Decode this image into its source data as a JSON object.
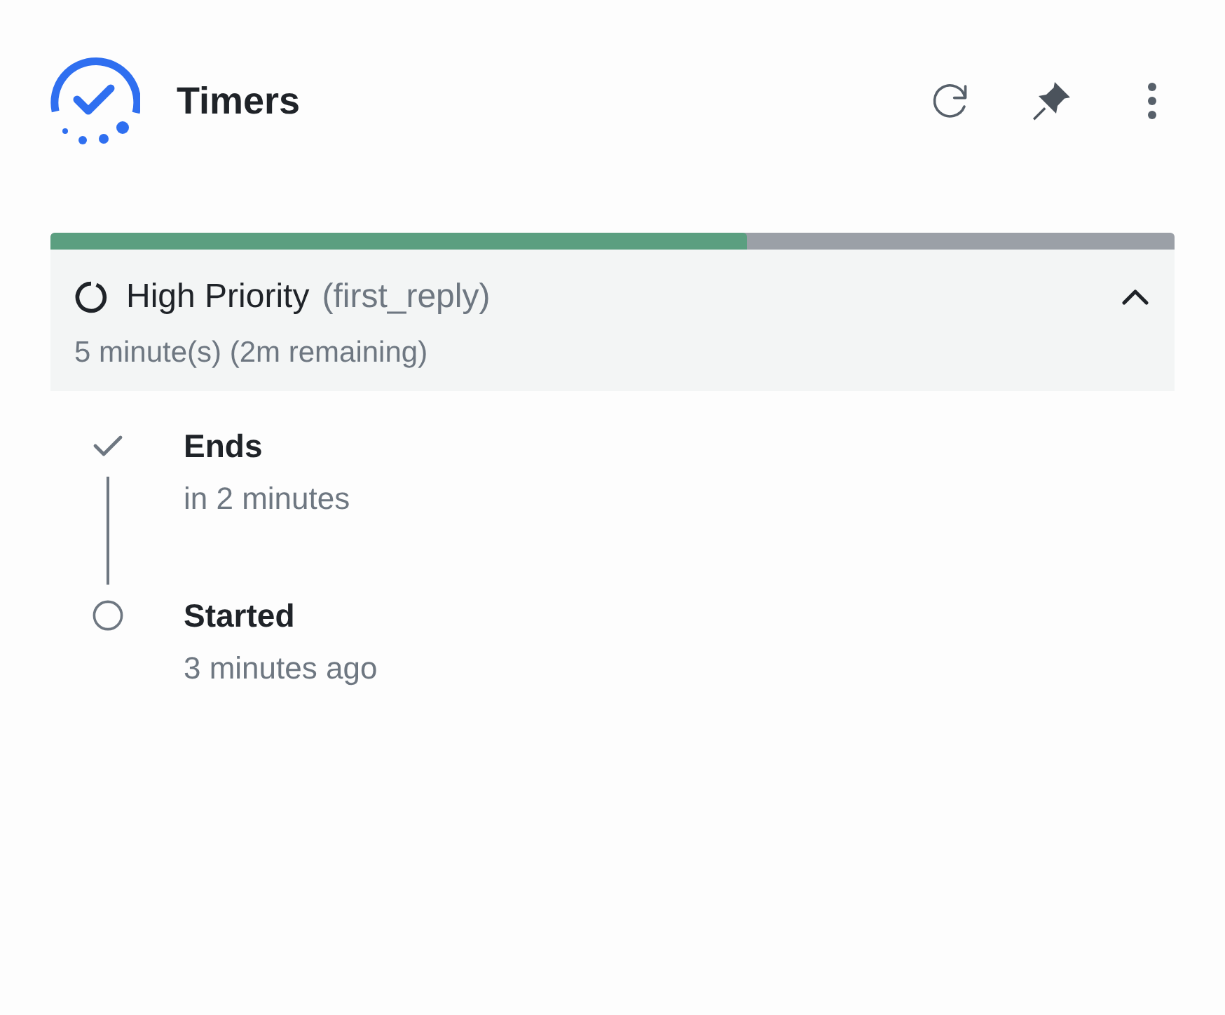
{
  "header": {
    "title": "Timers"
  },
  "progress": {
    "level": 0.62
  },
  "timer": {
    "name": "High Priority",
    "key": "(first_reply)",
    "detail": "5 minute(s) (2m remaining)",
    "expanded": true
  },
  "timeline": [
    {
      "kind": "check",
      "label": "Ends",
      "time": "in 2 minutes"
    },
    {
      "kind": "circle",
      "label": "Started",
      "time": "3 minutes ago"
    }
  ]
}
